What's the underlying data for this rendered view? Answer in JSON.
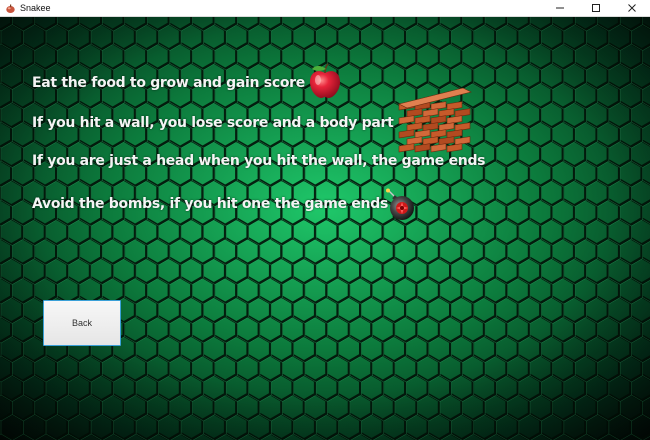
{
  "window": {
    "title": "Snakee",
    "icon": "snake-app-icon",
    "controls": [
      "minimize-icon",
      "maximize-icon",
      "close-icon"
    ]
  },
  "background": {
    "pattern": "hexagon-grid",
    "colors": {
      "glow": "#1fc86a",
      "dark": "#020805"
    }
  },
  "rules": [
    {
      "text": "Eat the food to grow and gain score",
      "icon": "apple-icon"
    },
    {
      "text": "If you hit a wall, you lose score and a body part",
      "icon": "brick-wall-icon"
    },
    {
      "text": "If you are just a head when you hit the wall, the game ends",
      "icon": ""
    },
    {
      "text": "Avoid the bombs, if you hit one the game ends",
      "icon": "bomb-icon"
    }
  ],
  "back_button": {
    "label": "Back"
  }
}
